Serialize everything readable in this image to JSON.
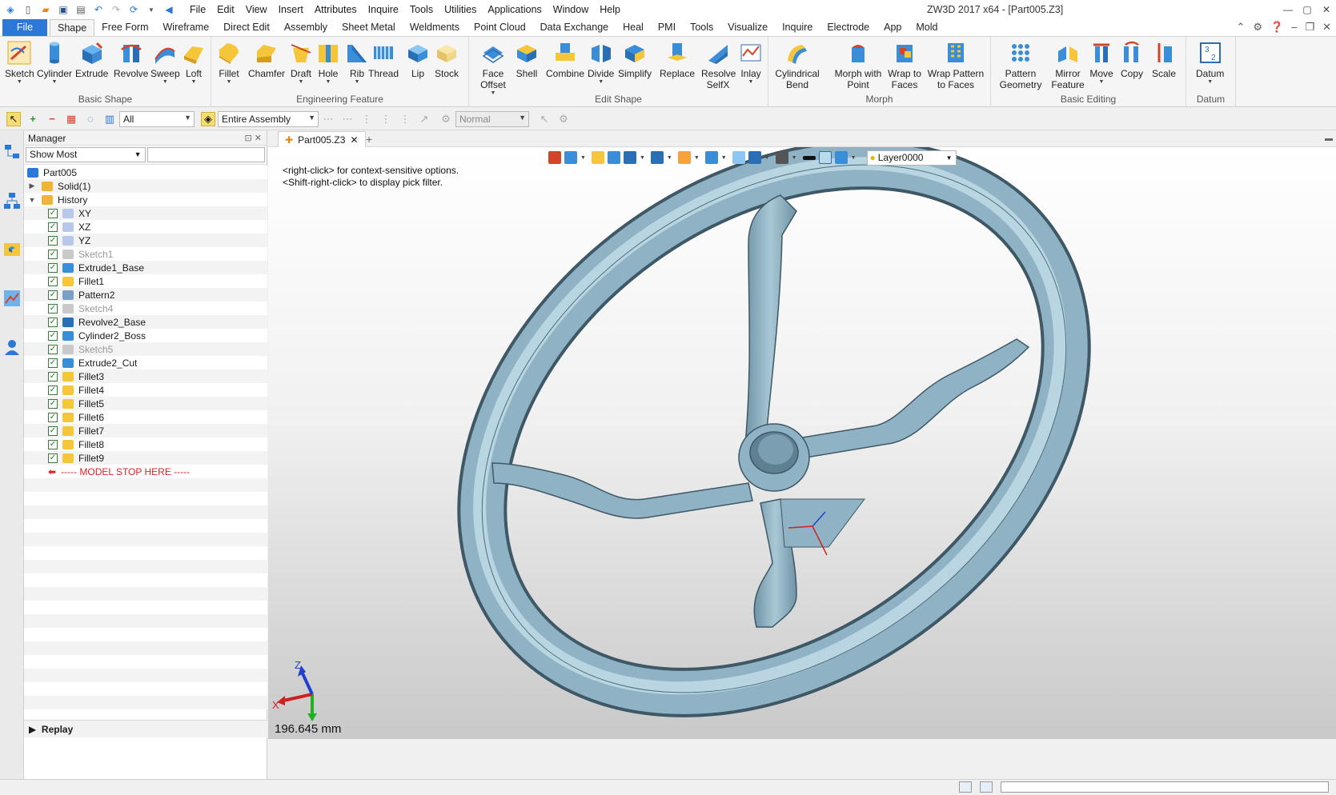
{
  "window": {
    "title": "ZW3D 2017  x64 - [Part005.Z3]"
  },
  "menu": [
    "File",
    "Edit",
    "View",
    "Insert",
    "Attributes",
    "Inquire",
    "Tools",
    "Utilities",
    "Applications",
    "Window",
    "Help"
  ],
  "tabs": [
    "File",
    "Shape",
    "Free Form",
    "Wireframe",
    "Direct Edit",
    "Assembly",
    "Sheet Metal",
    "Weldments",
    "Point Cloud",
    "Data Exchange",
    "Heal",
    "PMI",
    "Tools",
    "Visualize",
    "Inquire",
    "Electrode",
    "App",
    "Mold"
  ],
  "active_tab": "Shape",
  "ribbon": {
    "groups": [
      "Basic Shape",
      "Engineering Feature",
      "Edit Shape",
      "Morph",
      "Basic Editing",
      "Datum"
    ],
    "basic_shape": [
      "Sketch",
      "Cylinder",
      "Extrude",
      "Revolve",
      "Sweep",
      "Loft"
    ],
    "engineering_feature": [
      "Fillet",
      "Chamfer",
      "Draft",
      "Hole",
      "Rib",
      "Thread",
      "Lip",
      "Stock"
    ],
    "edit_shape": [
      "Face Offset",
      "Shell",
      "Combine",
      "Divide",
      "Simplify",
      "Replace",
      "Resolve SelfX",
      "Inlay"
    ],
    "morph": [
      "Cylindrical Bend",
      "Morph with Point",
      "Wrap to Faces",
      "Wrap Pattern to Faces"
    ],
    "basic_editing": [
      "Pattern Geometry",
      "Mirror Feature",
      "Move",
      "Copy",
      "Scale"
    ],
    "datum": [
      "Datum"
    ]
  },
  "command_bar": {
    "filter": "All",
    "scope": "Entire Assembly",
    "mode": "Normal"
  },
  "manager": {
    "title": "Manager",
    "filter": "Show Most",
    "tree": [
      {
        "label": "Part005",
        "level": 0,
        "icon": "part-icon"
      },
      {
        "label": "Solid(1)",
        "level": 1,
        "icon": "folder-icon"
      },
      {
        "label": "History",
        "level": 1,
        "icon": "folder-icon"
      },
      {
        "label": "XY",
        "level": 2,
        "icon": "plane-icon",
        "checked": true
      },
      {
        "label": "XZ",
        "level": 2,
        "icon": "plane-icon",
        "checked": true
      },
      {
        "label": "YZ",
        "level": 2,
        "icon": "plane-icon",
        "checked": true
      },
      {
        "label": "Sketch1",
        "level": 2,
        "icon": "sketch-icon",
        "checked": true,
        "dim": true
      },
      {
        "label": "Extrude1_Base",
        "level": 2,
        "icon": "extrude-icon",
        "checked": true
      },
      {
        "label": "Fillet1",
        "level": 2,
        "icon": "fillet-icon",
        "checked": true
      },
      {
        "label": "Pattern2",
        "level": 2,
        "icon": "pattern-icon",
        "checked": true
      },
      {
        "label": "Sketch4",
        "level": 2,
        "icon": "sketch-icon",
        "checked": true,
        "dim": true
      },
      {
        "label": "Revolve2_Base",
        "level": 2,
        "icon": "revolve-icon",
        "checked": true
      },
      {
        "label": "Cylinder2_Boss",
        "level": 2,
        "icon": "cylinder-icon",
        "checked": true
      },
      {
        "label": "Sketch5",
        "level": 2,
        "icon": "sketch-icon",
        "checked": true,
        "dim": true
      },
      {
        "label": "Extrude2_Cut",
        "level": 2,
        "icon": "extrude-icon",
        "checked": true
      },
      {
        "label": "Fillet3",
        "level": 2,
        "icon": "fillet-icon",
        "checked": true
      },
      {
        "label": "Fillet4",
        "level": 2,
        "icon": "fillet-icon",
        "checked": true
      },
      {
        "label": "Fillet5",
        "level": 2,
        "icon": "fillet-icon",
        "checked": true
      },
      {
        "label": "Fillet6",
        "level": 2,
        "icon": "fillet-icon",
        "checked": true
      },
      {
        "label": "Fillet7",
        "level": 2,
        "icon": "fillet-icon",
        "checked": true
      },
      {
        "label": "Fillet8",
        "level": 2,
        "icon": "fillet-icon",
        "checked": true
      },
      {
        "label": "Fillet9",
        "level": 2,
        "icon": "fillet-icon",
        "checked": true
      }
    ],
    "stop_marker": "----- MODEL STOP HERE -----",
    "replay": "Replay"
  },
  "document": {
    "tab": "Part005.Z3",
    "hint_lines": [
      "<right-click> for context-sensitive options.",
      "<Shift-right-click> to display pick filter."
    ],
    "layer": "Layer0000",
    "scale_readout": "196.645 mm",
    "axes": {
      "x": "X",
      "z": "Z"
    }
  },
  "colors": {
    "accent": "#2b78d7",
    "model": "#8fb3c4",
    "stop": "#e0202a"
  }
}
